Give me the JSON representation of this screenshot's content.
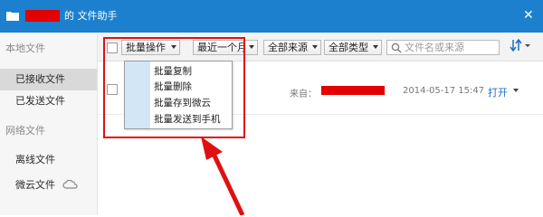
{
  "window": {
    "title": "的 文件助手",
    "redacted_color": "#e30000",
    "titlebar_color": "#1c80cf",
    "close_glyph": "✕",
    "folder_icon": "folder-icon"
  },
  "sidebar": {
    "local_group": "本地文件",
    "items_local": [
      {
        "label": "已接收文件",
        "active": true
      },
      {
        "label": "已发送文件",
        "active": false
      }
    ],
    "network_group": "网络文件",
    "items_network": [
      {
        "label": "离线文件"
      },
      {
        "label": "微云文件",
        "icon": "cloud-icon"
      }
    ]
  },
  "toolbar": {
    "batch_button": "批量操作",
    "time_filter": "最近一个月",
    "source_filter": "全部来源",
    "type_filter": "全部类型",
    "search_placeholder": "文件名或来源",
    "sort_icon": "sort-icon"
  },
  "file_row": {
    "from_label": "来自：",
    "date": "2014-05-17 15:47",
    "open_label": "打开"
  },
  "batch_menu": {
    "items": [
      "批量复制",
      "批量删除",
      "批量存到微云",
      "批量发送到手机"
    ]
  },
  "annotation": {
    "color": "#e01010"
  }
}
